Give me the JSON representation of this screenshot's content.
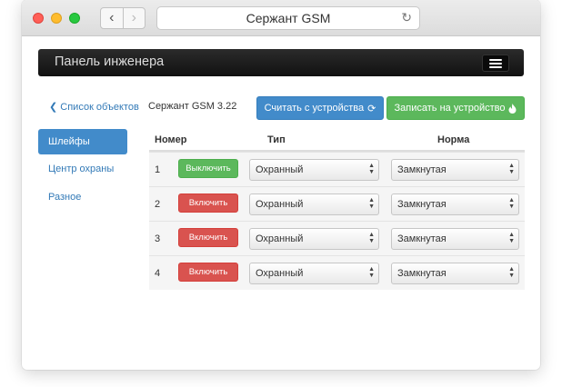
{
  "browser": {
    "address_title": "Сержант GSM",
    "back_glyph": "‹",
    "forward_glyph": "›",
    "reload_glyph": "↻"
  },
  "navbar": {
    "brand": "Панель инженера",
    "menu_icon": "hamburger-icon"
  },
  "sidebar": {
    "back_label": "Список объектов",
    "back_icon": "chevron-left-icon",
    "items": [
      {
        "label": "Шлейфы",
        "active": true
      },
      {
        "label": "Центр охраны",
        "active": false
      },
      {
        "label": "Разное",
        "active": false
      }
    ]
  },
  "toolbar": {
    "device_title": "Сержант GSM 3.22",
    "read_label": "Считать с устройства",
    "read_icon": "refresh-icon",
    "write_label": "Записать на устройство",
    "write_icon": "fire-icon"
  },
  "table": {
    "columns": [
      "Номер",
      "Тип",
      "Норма"
    ],
    "rows": [
      {
        "num": "1",
        "toggle": "Выключить",
        "state": "on",
        "type": "Охранный",
        "norm": "Замкнутая"
      },
      {
        "num": "2",
        "toggle": "Включить",
        "state": "off",
        "type": "Охранный",
        "norm": "Замкнутая"
      },
      {
        "num": "3",
        "toggle": "Включить",
        "state": "off",
        "type": "Охранный",
        "norm": "Замкнутая"
      },
      {
        "num": "4",
        "toggle": "Включить",
        "state": "off",
        "type": "Охранный",
        "norm": "Замкнутая"
      }
    ]
  },
  "colors": {
    "primary": "#428bca",
    "success": "#5cb85c",
    "danger": "#d9534f",
    "navbar": "#1a1a1a"
  }
}
